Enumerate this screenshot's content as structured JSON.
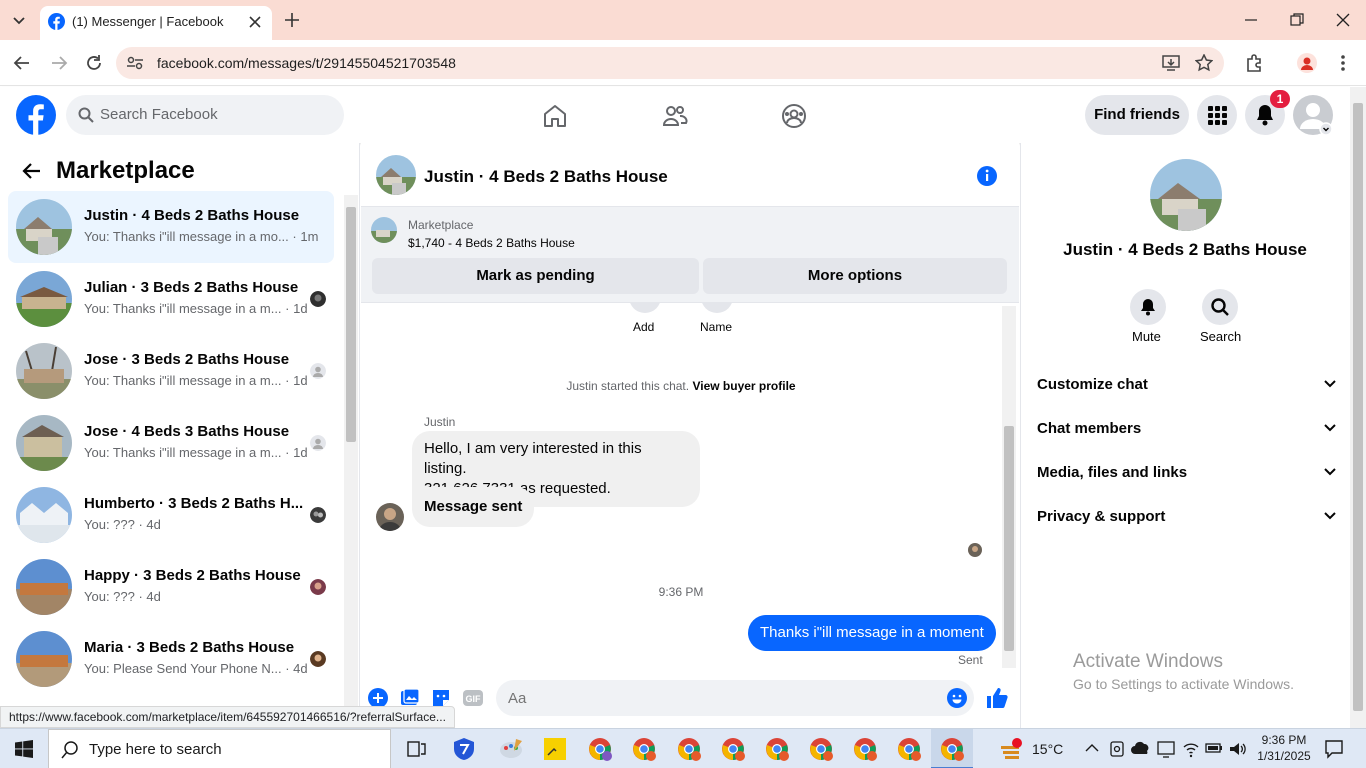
{
  "browser": {
    "tab_title": "(1) Messenger | Facebook",
    "url": "facebook.com/messages/t/29145504521703548",
    "status_url": "https://www.facebook.com/marketplace/item/645592701466516/?referralSurface..."
  },
  "header": {
    "search_placeholder": "Search Facebook",
    "find_friends": "Find friends",
    "notification_count": "1",
    "brand_color": "#0866ff"
  },
  "sidebar": {
    "title": "Marketplace",
    "items": [
      {
        "name": "Justin · 4 Beds 2 Baths House",
        "preview": "You: Thanks i\"ill message in a mo...",
        "time": "· 1m",
        "selected": true
      },
      {
        "name": "Julian · 3 Beds 2 Baths House",
        "preview": "You: Thanks i\"ill message in a m...",
        "time": "· 1d"
      },
      {
        "name": "Jose · 3 Beds 2 Baths House",
        "preview": "You: Thanks i\"ill message in a m...",
        "time": "· 1d"
      },
      {
        "name": "Jose · 4 Beds 3 Baths House",
        "preview": "You: Thanks i\"ill message in a m...",
        "time": "· 1d"
      },
      {
        "name": "Humberto · 3 Beds 2 Baths H...",
        "preview": "You: ???",
        "time": "· 4d"
      },
      {
        "name": "Happy · 3 Beds 2 Baths House",
        "preview": "You: ???",
        "time": "· 4d"
      },
      {
        "name": "Maria · 3 Beds 2 Baths House",
        "preview": "You: Please Send Your Phone N...",
        "time": "· 4d"
      }
    ]
  },
  "chat": {
    "title": "Justin · 4 Beds 2 Baths House",
    "listing_source": "Marketplace",
    "listing_title": "$1,740 - 4 Beds 2 Baths House",
    "mark_pending": "Mark as pending",
    "more_options": "More options",
    "add_label": "Add",
    "name_label": "Name",
    "started_text": "Justin started this chat.",
    "view_buyer": "View buyer profile",
    "sender_name": "Justin",
    "msg1_line1": "Hello, I am very interested in this listing.",
    "msg1_line2": "321 626 7331 as requested.",
    "msg2": "Message sent",
    "timestamp": "9:36 PM",
    "my_message": "Thanks i\"ill message in a moment",
    "sent_label": "Sent",
    "input_placeholder": "Aa"
  },
  "right_panel": {
    "title": "Justin · 4 Beds 2 Baths House",
    "mute": "Mute",
    "search": "Search",
    "sections": [
      "Customize chat",
      "Chat members",
      "Media, files and links",
      "Privacy & support"
    ]
  },
  "watermark": {
    "line1": "Activate Windows",
    "line2": "Go to Settings to activate Windows."
  },
  "taskbar": {
    "search_placeholder": "Type here to search",
    "weather": "15°C",
    "time": "9:36 PM",
    "date": "1/31/2025"
  }
}
